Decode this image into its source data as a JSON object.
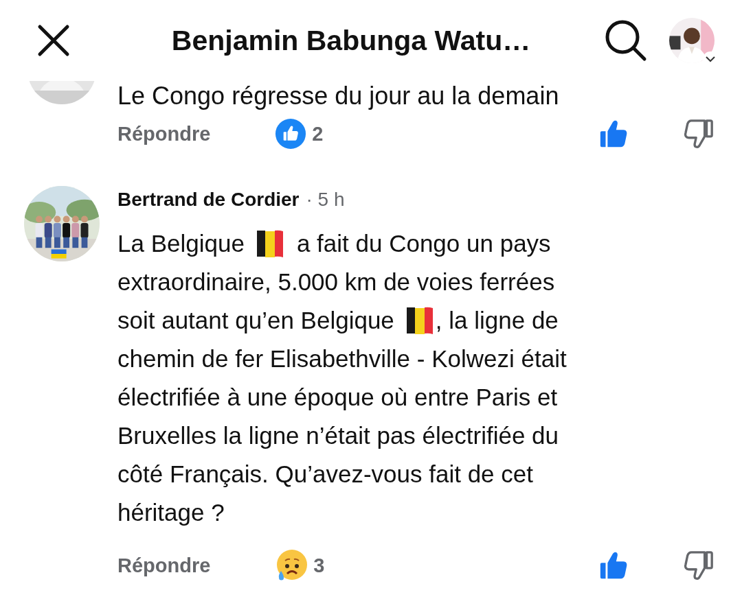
{
  "header": {
    "title": "Benjamin Babunga Watu…"
  },
  "comments": [
    {
      "lines": [
        [
          {
            "kind": "text",
            "text": "Le Congo régresse du jour au la demain"
          }
        ]
      ],
      "reply": "Répondre",
      "reaction": {
        "kind": "like",
        "count": "2"
      },
      "upvoted": true,
      "downvoted": false
    },
    {
      "author": "Bertrand de Cordier",
      "time": "· 5 h",
      "lines": [
        [
          {
            "kind": "text",
            "text": "La Belgique"
          },
          {
            "kind": "flag"
          },
          {
            "kind": "text",
            "text": "a fait du Congo un pays"
          }
        ],
        [
          {
            "kind": "text",
            "text": "extraordinaire, 5.000 km de voies ferrées"
          }
        ],
        [
          {
            "kind": "text",
            "text": "soit autant qu’en Belgique"
          },
          {
            "kind": "flag"
          },
          {
            "kind": "text",
            "text": ", la ligne de"
          }
        ],
        [
          {
            "kind": "text",
            "text": "chemin de fer Elisabethville - Kolwezi était"
          }
        ],
        [
          {
            "kind": "text",
            "text": "électrifiée à une époque où entre Paris et"
          }
        ],
        [
          {
            "kind": "text",
            "text": "Bruxelles la ligne n’était pas électrifiée du"
          }
        ],
        [
          {
            "kind": "text",
            "text": "côté Français. Qu’avez-vous fait de cet"
          }
        ],
        [
          {
            "kind": "text",
            "text": "héritage ?"
          }
        ]
      ],
      "reply": "Répondre",
      "reaction": {
        "kind": "sad",
        "count": "3"
      },
      "upvoted": true,
      "downvoted": false
    }
  ]
}
